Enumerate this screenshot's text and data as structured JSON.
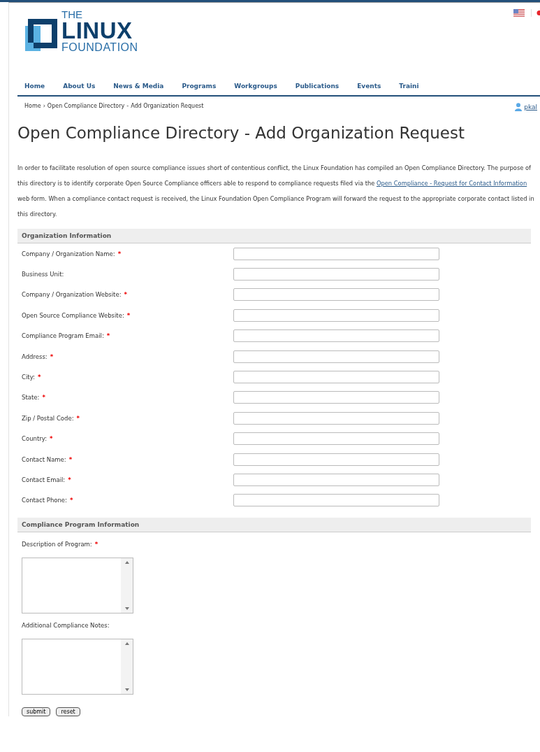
{
  "logo": {
    "line_1": "THE",
    "line_2": "LINUX",
    "line_3": "FOUNDATION"
  },
  "nav": [
    {
      "label": "Home"
    },
    {
      "label": "About Us"
    },
    {
      "label": "News & Media"
    },
    {
      "label": "Programs"
    },
    {
      "label": "Workgroups"
    },
    {
      "label": "Publications"
    },
    {
      "label": "Events"
    },
    {
      "label": "Traini"
    }
  ],
  "breadcrumb": {
    "items": [
      "Home",
      "Open Compliance Directory"
    ],
    "current": "Add Organization Request",
    "separator": "›",
    "dash": "-"
  },
  "user_link": "pkal",
  "title": "Open Compliance Directory - Add Organization Request",
  "intro": {
    "before": "In order to facilitate resolution of open source compliance issues short of contentious conflict, the Linux Foundation has compiled an Open Compliance Directory. The purpose of this directory is to identify corporate Open Source Compliance officers able to respond to compliance requests filed via the",
    "link": "Open Compliance - Request for Contact Information",
    "after": "web form. When a compliance contact request is received, the Linux Foundation Open Compliance Program will forward the request to the appropriate corporate contact listed in this directory."
  },
  "sections": [
    {
      "heading": "Organization Information",
      "fields": [
        {
          "kind": "input",
          "label": "Company / Organization Name:",
          "marker": "*"
        },
        {
          "kind": "input",
          "label": "Business Unit:"
        },
        {
          "kind": "input",
          "label": "Company / Organization Website:",
          "marker": "*"
        },
        {
          "kind": "input",
          "label": "Open Source Compliance Website:",
          "marker": "*"
        },
        {
          "kind": "input",
          "label": "Compliance Program Email:",
          "marker": "*"
        },
        {
          "kind": "input",
          "label": "Address:",
          "marker": "*"
        },
        {
          "kind": "input",
          "label": "City:",
          "marker": "*"
        },
        {
          "kind": "input",
          "label": "State:",
          "marker": "*"
        },
        {
          "kind": "input",
          "label": "Zip / Postal Code:",
          "marker": "*"
        },
        {
          "kind": "input",
          "label": "Country:",
          "marker": "*"
        },
        {
          "kind": "input",
          "label": "Contact Name:",
          "marker": "*"
        },
        {
          "kind": "input",
          "label": "Contact Email:",
          "marker": "*"
        },
        {
          "kind": "input",
          "label": "Contact Phone:",
          "marker": "*"
        }
      ]
    },
    {
      "heading": "Compliance Program Information",
      "fields": [
        {
          "kind": "textarea",
          "label": "Description of Program:",
          "marker": "*"
        },
        {
          "kind": "textarea",
          "label": "Additional Compliance Notes:"
        }
      ]
    }
  ],
  "buttons": [
    "submit",
    "reset"
  ]
}
